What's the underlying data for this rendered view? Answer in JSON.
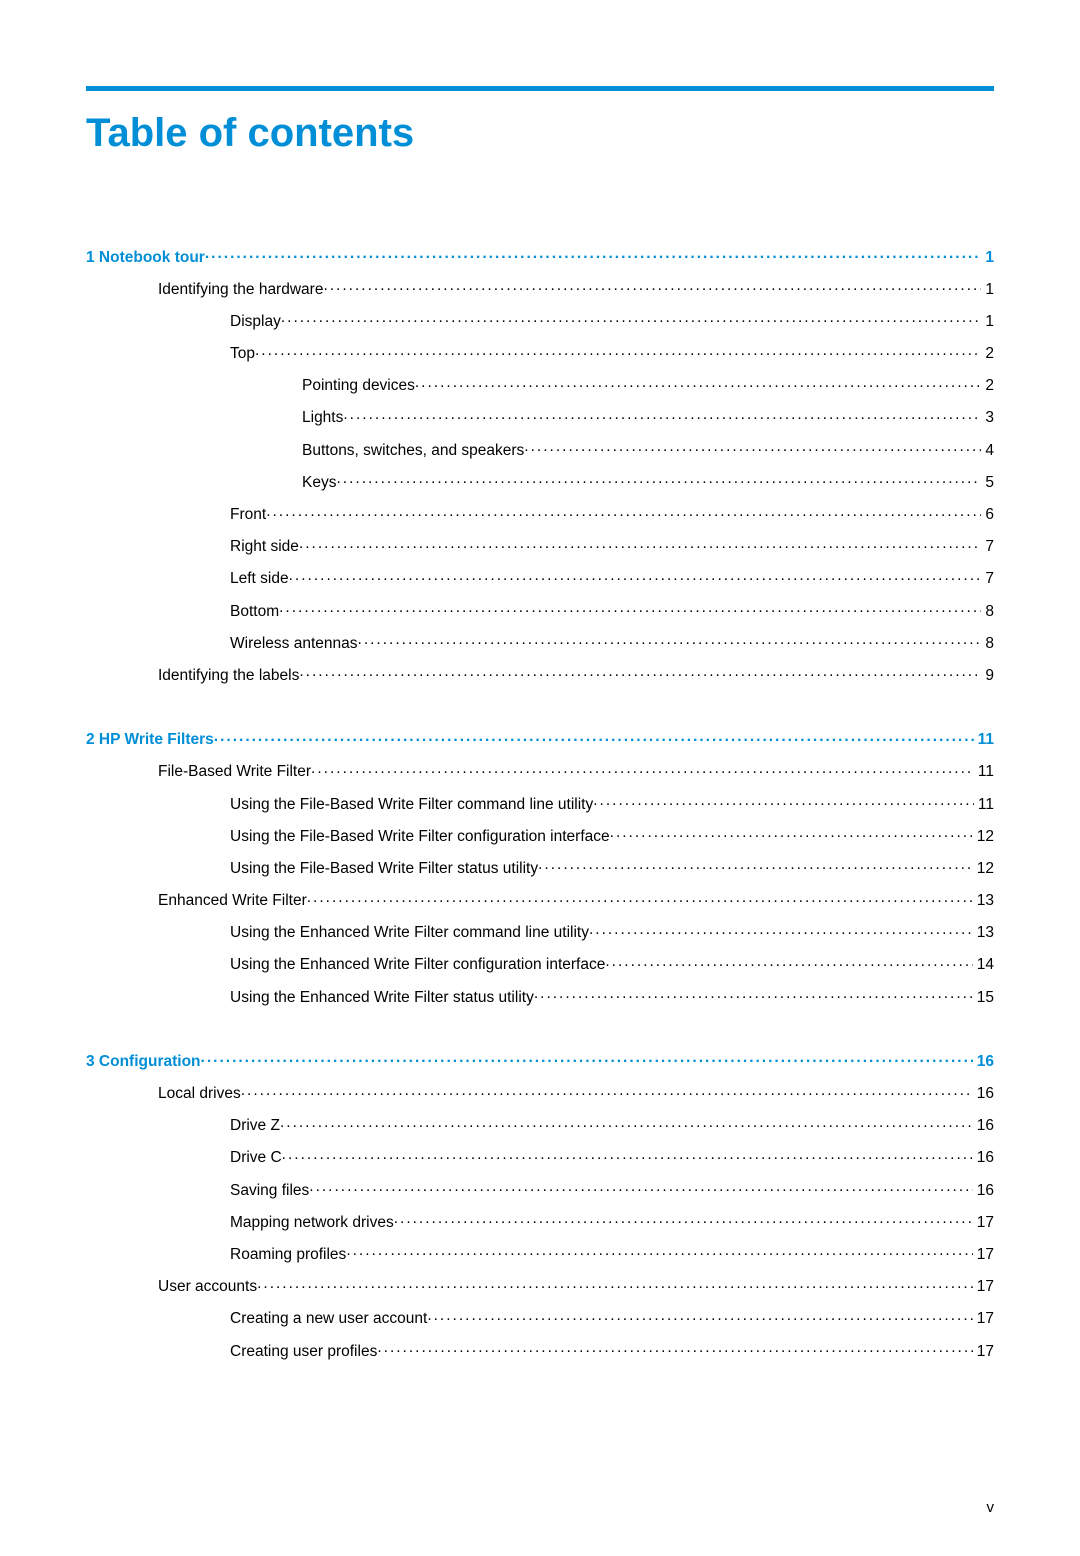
{
  "title": "Table of contents",
  "footer": "v",
  "toc": [
    {
      "level": 0,
      "label": "1  Notebook tour",
      "page": "1",
      "chapter": true
    },
    {
      "level": 1,
      "label": "Identifying the hardware",
      "page": "1"
    },
    {
      "level": 2,
      "label": "Display",
      "page": "1"
    },
    {
      "level": 2,
      "label": "Top",
      "page": "2"
    },
    {
      "level": 3,
      "label": "Pointing devices",
      "page": "2"
    },
    {
      "level": 3,
      "label": "Lights",
      "page": "3"
    },
    {
      "level": 3,
      "label": "Buttons, switches, and speakers",
      "page": "4"
    },
    {
      "level": 3,
      "label": "Keys",
      "page": "5"
    },
    {
      "level": 2,
      "label": "Front",
      "page": "6"
    },
    {
      "level": 2,
      "label": "Right side",
      "page": "7"
    },
    {
      "level": 2,
      "label": "Left side",
      "page": "7"
    },
    {
      "level": 2,
      "label": "Bottom",
      "page": "8"
    },
    {
      "level": 2,
      "label": "Wireless antennas",
      "page": "8"
    },
    {
      "level": 1,
      "label": "Identifying the labels",
      "page": "9"
    },
    {
      "gap": true
    },
    {
      "level": 0,
      "label": "2  HP Write Filters",
      "page": "11",
      "chapter": true
    },
    {
      "level": 1,
      "label": "File-Based Write Filter",
      "page": "11"
    },
    {
      "level": 2,
      "label": "Using the File-Based Write Filter command line utility",
      "page": "11"
    },
    {
      "level": 2,
      "label": "Using the File-Based Write Filter configuration interface",
      "page": "12"
    },
    {
      "level": 2,
      "label": "Using the File-Based Write Filter status utility",
      "page": "12"
    },
    {
      "level": 1,
      "label": "Enhanced Write Filter",
      "page": "13"
    },
    {
      "level": 2,
      "label": "Using the Enhanced Write Filter command line utility",
      "page": "13"
    },
    {
      "level": 2,
      "label": "Using the Enhanced Write Filter configuration interface",
      "page": "14"
    },
    {
      "level": 2,
      "label": "Using the Enhanced Write Filter status utility",
      "page": "15"
    },
    {
      "gap": true
    },
    {
      "level": 0,
      "label": "3  Configuration",
      "page": "16",
      "chapter": true
    },
    {
      "level": 1,
      "label": "Local drives",
      "page": "16"
    },
    {
      "level": 2,
      "label": "Drive Z",
      "page": "16"
    },
    {
      "level": 2,
      "label": "Drive C",
      "page": "16"
    },
    {
      "level": 2,
      "label": "Saving files",
      "page": "16"
    },
    {
      "level": 2,
      "label": "Mapping network drives",
      "page": "17"
    },
    {
      "level": 2,
      "label": "Roaming profiles",
      "page": "17"
    },
    {
      "level": 1,
      "label": "User accounts",
      "page": "17"
    },
    {
      "level": 2,
      "label": "Creating a new user account",
      "page": "17"
    },
    {
      "level": 2,
      "label": "Creating user profiles",
      "page": "17"
    }
  ]
}
